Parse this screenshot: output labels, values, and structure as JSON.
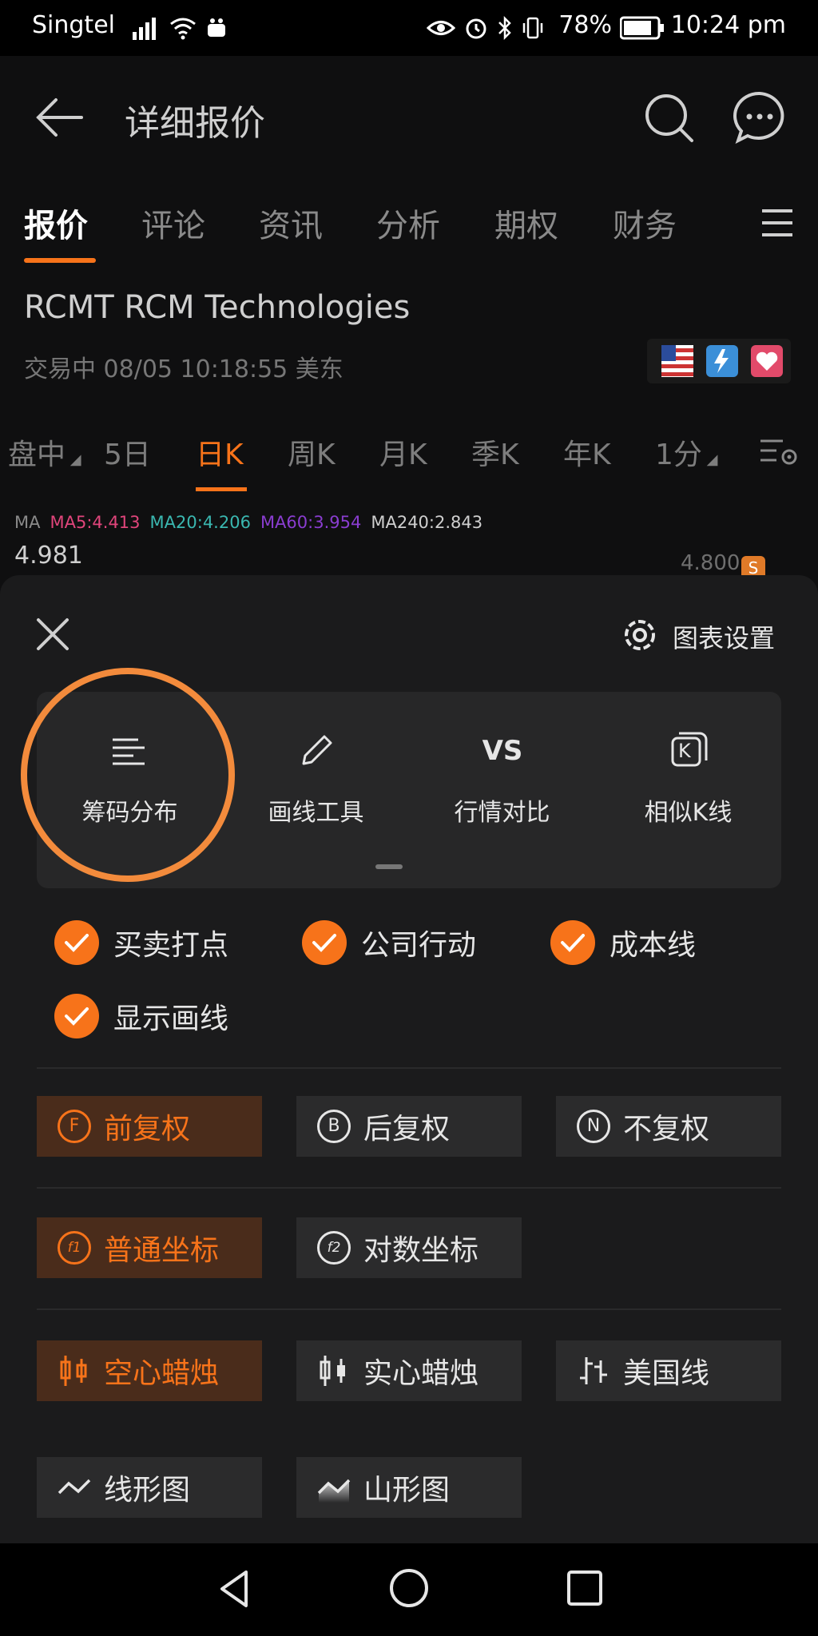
{
  "status_bar": {
    "carrier": "Singtel",
    "battery": "78%",
    "time": "10:24 pm"
  },
  "header": {
    "title": "详细报价"
  },
  "tabs": [
    "报价",
    "评论",
    "资讯",
    "分析",
    "期权",
    "财务"
  ],
  "stock": {
    "name": "RCMT  RCM Technologies",
    "status": "交易中   08/05 10:18:55 美东"
  },
  "period_tabs": [
    "盘中",
    "5日",
    "日K",
    "周K",
    "月K",
    "季K",
    "年K",
    "1分"
  ],
  "ma": {
    "label": "MA",
    "ma5": "MA5:4.413",
    "ma20": "MA20:4.206",
    "ma60": "MA60:3.954",
    "ma240": "MA240:2.843",
    "colors": {
      "ma5": "#e0457b",
      "ma20": "#3ab7b0",
      "ma60": "#8a3dd0",
      "ma240": "#cfcfcf"
    }
  },
  "prices": {
    "top": "4.981",
    "right": "4.800",
    "s_badge": "S"
  },
  "sheet": {
    "settings_label": "图表设置",
    "tools": [
      "筹码分布",
      "画线工具",
      "行情对比",
      "相似K线"
    ],
    "vs_text": "VS",
    "k_text": "K",
    "checks": [
      "买卖打点",
      "公司行动",
      "成本线",
      "显示画线"
    ],
    "adjust": [
      "前复权",
      "后复权",
      "不复权"
    ],
    "adjust_letters": [
      "F",
      "B",
      "N"
    ],
    "axis": [
      "普通坐标",
      "对数坐标"
    ],
    "axis_letters": [
      "f1",
      "f2"
    ],
    "chart_styles": [
      "空心蜡烛",
      "实心蜡烛",
      "美国线"
    ],
    "line_styles": [
      "线形图",
      "山形图"
    ]
  },
  "accent_color": "#f7731a"
}
